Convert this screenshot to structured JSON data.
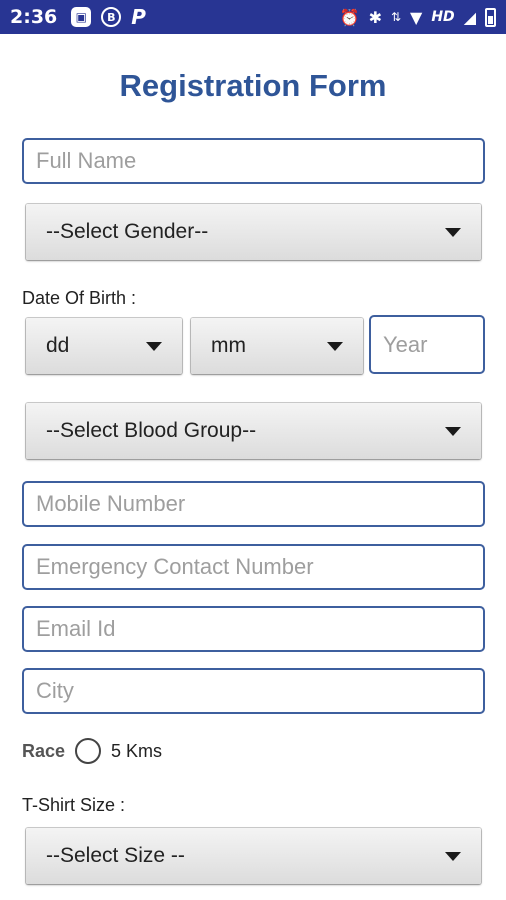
{
  "status_bar": {
    "time": "2:36",
    "icons": [
      "image-notification-icon",
      "b-notification-icon",
      "p-notification-icon",
      "alarm-icon",
      "bluetooth-icon",
      "data-arrows-icon",
      "wifi-icon",
      "signal-icon",
      "battery-icon"
    ],
    "b_badge": "B",
    "p_badge": "P",
    "network": "HD"
  },
  "form": {
    "title": "Registration Form",
    "full_name": {
      "placeholder": "Full Name",
      "value": ""
    },
    "gender": {
      "selected": "--Select Gender--"
    },
    "dob_label": "Date Of Birth :",
    "dob_day": {
      "selected": "dd"
    },
    "dob_month": {
      "selected": "mm"
    },
    "dob_year": {
      "placeholder": "Year",
      "value": ""
    },
    "blood_group": {
      "selected": "--Select Blood Group--"
    },
    "mobile": {
      "placeholder": "Mobile Number",
      "value": ""
    },
    "emergency": {
      "placeholder": "Emergency Contact Number",
      "value": ""
    },
    "email": {
      "placeholder": "Email Id",
      "value": ""
    },
    "city": {
      "placeholder": "City",
      "value": ""
    },
    "race_label": "Race",
    "race_option": "5 Kms",
    "tshirt_label": "T-Shirt Size :",
    "tshirt": {
      "selected": "--Select Size --"
    }
  },
  "colors": {
    "status_bar": "#283593",
    "title": "#2f5597",
    "field_border": "#3e5f9e"
  }
}
